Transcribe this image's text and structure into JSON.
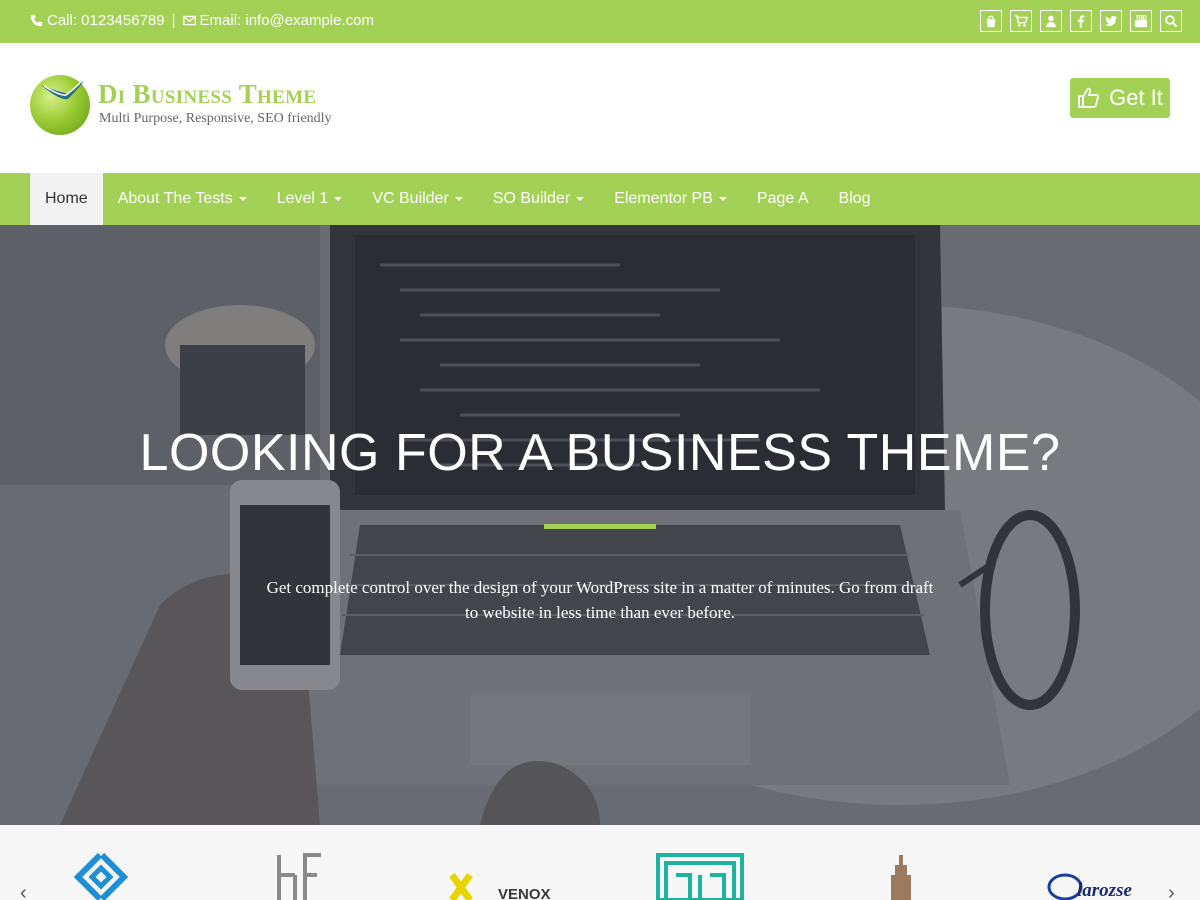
{
  "topbar": {
    "call": "Call: 0123456789",
    "separator": "|",
    "email": "Email: info@example.com",
    "icons": [
      "shopping-bag-icon",
      "cart-icon",
      "user-icon",
      "facebook-icon",
      "twitter-icon",
      "youtube-icon",
      "search-icon"
    ]
  },
  "header": {
    "title": "Di Business Theme",
    "tagline": "Multi Purpose, Responsive, SEO friendly",
    "cta": "Get It"
  },
  "nav": {
    "items": [
      {
        "label": "Home",
        "active": true,
        "dropdown": false
      },
      {
        "label": "About The Tests",
        "dropdown": true
      },
      {
        "label": "Level 1",
        "dropdown": true
      },
      {
        "label": "VC Builder",
        "dropdown": true
      },
      {
        "label": "SO Builder",
        "dropdown": true
      },
      {
        "label": "Elementor PB",
        "dropdown": true
      },
      {
        "label": "Page A",
        "dropdown": false
      },
      {
        "label": "Blog",
        "dropdown": false
      }
    ]
  },
  "hero": {
    "title": "LOOKING FOR A BUSINESS THEME?",
    "description": "Get complete control over the design of your WordPress site in a matter of minutes. Go from draft to website in less time than ever before."
  },
  "logos": {
    "prev": "‹",
    "next": "›",
    "brand_venox": "VENOX",
    "brand_larozse": "larozse"
  },
  "colors": {
    "accent": "#a3d155"
  }
}
